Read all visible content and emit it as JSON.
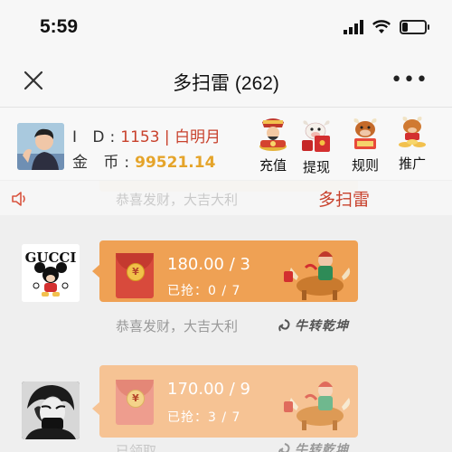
{
  "status_bar": {
    "time": "5:59"
  },
  "nav": {
    "title": "多扫雷 (262)"
  },
  "user": {
    "id_label": "I D:",
    "id_value": "1153",
    "separator": " | ",
    "name": "白明月",
    "coin_label": "金 币:",
    "coin_value": "99521.14"
  },
  "actions": [
    {
      "label": "充值",
      "icon": "god-of-wealth-icon"
    },
    {
      "label": "提现",
      "icon": "ox-red-envelope-icon"
    },
    {
      "label": "规则",
      "icon": "ox-scroll-icon"
    },
    {
      "label": "推广",
      "icon": "ox-coins-icon"
    }
  ],
  "banner": {
    "title": "多扫雷",
    "faded_caption": "恭喜发财，大吉大利",
    "icon": "speaker-icon"
  },
  "messages": [
    {
      "avatar": "gucci-mickey-avatar",
      "avatar_text": "GUCCI",
      "amount": "180.00 / 3",
      "grabbed": "已抢：0 / 7",
      "caption": "恭喜发财，大吉大利",
      "brand": "牛转乾坤",
      "bubble_color": "#efa154"
    },
    {
      "avatar": "dark-anime-avatar",
      "amount": "170.00 / 9",
      "grabbed": "已抢：3 / 7",
      "caption": "已领取",
      "brand": "牛转乾坤",
      "bubble_color": "#f6c394"
    }
  ],
  "colors": {
    "accent_red": "#c8412c",
    "coin_gold": "#e5a42a",
    "bubble_active": "#efa154",
    "bubble_opened": "#f6c394"
  }
}
